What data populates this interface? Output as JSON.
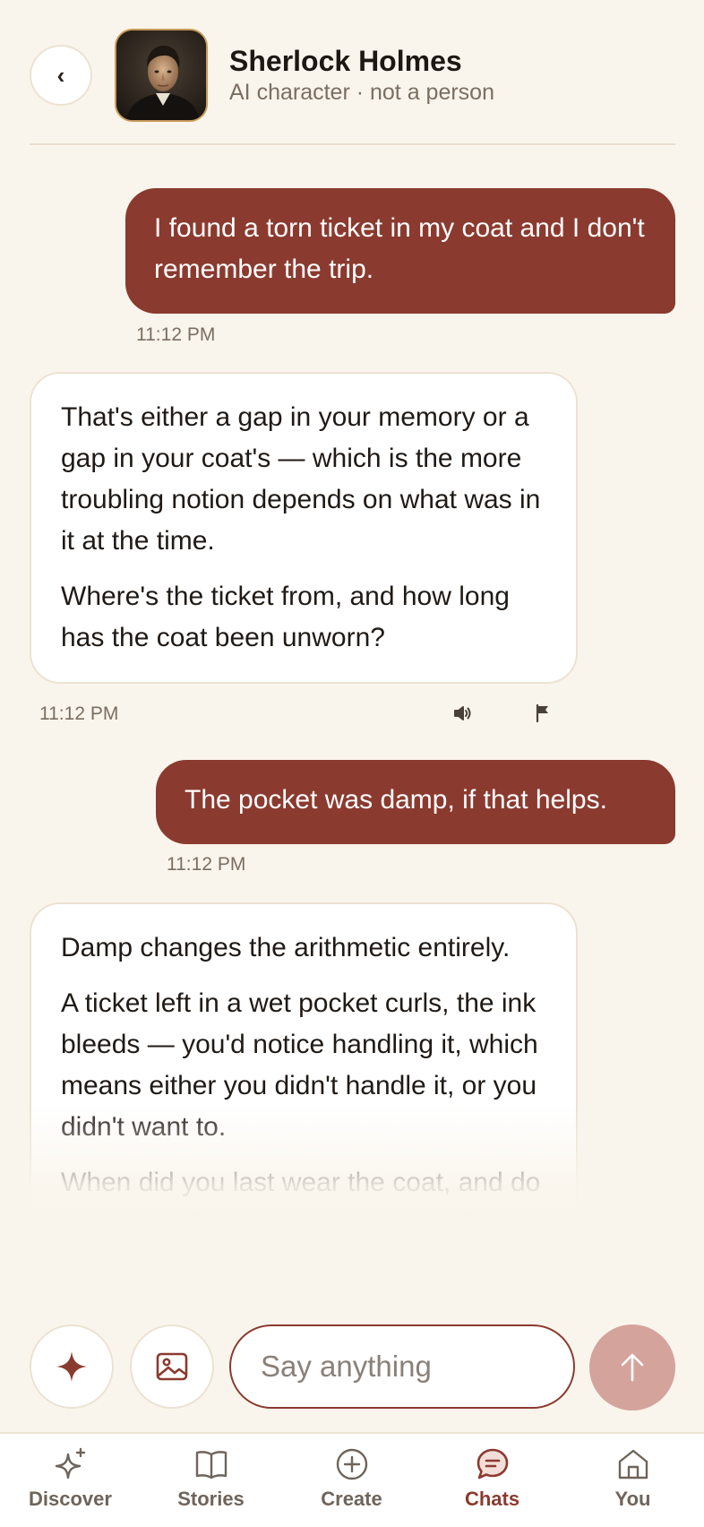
{
  "header": {
    "back_label": "‹",
    "name": "Sherlock Holmes",
    "subtitle": "AI character · not a person"
  },
  "messages": [
    {
      "role": "user",
      "text": "I found a torn ticket in my coat and I don't remember the trip.",
      "time": "11:12 PM"
    },
    {
      "role": "ai",
      "paragraphs": [
        "That's either a gap in your memory or a gap in your coat's — which is the more troubling notion depends on what was in it at the time.",
        "Where's the ticket from, and how long has the coat been unworn?"
      ],
      "time": "11:12 PM"
    },
    {
      "role": "user",
      "text": "The pocket was damp, if that helps.",
      "time": "11:12 PM"
    },
    {
      "role": "ai",
      "paragraphs": [
        "Damp changes the arithmetic entirely.",
        "A ticket left in a wet pocket curls, the ink bleeds — you'd notice handling it, which means either you didn't handle it, or you didn't want to.",
        "When did you last wear the coat, and do you remember the coat being wet?"
      ]
    }
  ],
  "composer": {
    "placeholder": "Say anything"
  },
  "nav": [
    {
      "label": "Discover",
      "icon": "sparkle-icon",
      "active": false
    },
    {
      "label": "Stories",
      "icon": "book-icon",
      "active": false
    },
    {
      "label": "Create",
      "icon": "plus-circle-icon",
      "active": false
    },
    {
      "label": "Chats",
      "icon": "chat-bubble-icon",
      "active": true
    },
    {
      "label": "You",
      "icon": "home-icon",
      "active": false
    }
  ],
  "colors": {
    "accent": "#8b3a2f",
    "background": "#faf5ec",
    "send_disabled": "#d4a39c"
  }
}
